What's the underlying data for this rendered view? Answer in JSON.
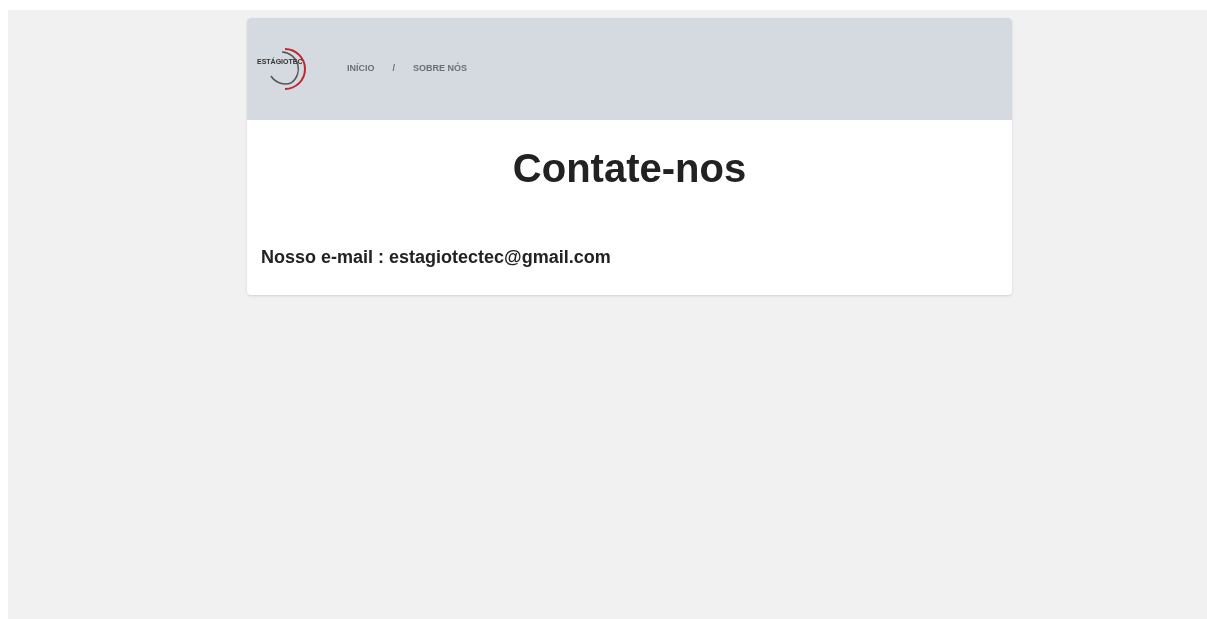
{
  "logo": {
    "text": "ESTÁGIOTEC"
  },
  "nav": [
    {
      "label": "INÍCIO"
    },
    {
      "label": "SOBRE NÓS"
    }
  ],
  "nav_separator": "/",
  "title": "Contate-nos",
  "email_line": "Nosso e-mail : estagiotectec@gmail.com"
}
